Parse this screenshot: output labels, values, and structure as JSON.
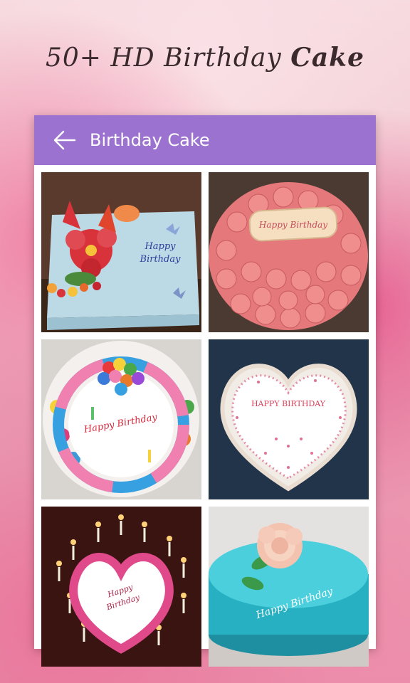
{
  "promo": {
    "headline_prefix": "50+ HD Birthday",
    "headline_emphasis": "Cake"
  },
  "appbar": {
    "back_icon": "arrow-left-icon",
    "title": "Birthday Cake"
  },
  "cakes": [
    {
      "id": "cake-1",
      "caption_line1": "Happy",
      "caption_line2": "Birthday",
      "theme": "light-blue sheet cake with red flowers and butterflies"
    },
    {
      "id": "cake-2",
      "caption_line1": "Happy Birthday",
      "theme": "pink rosette cake with plaque"
    },
    {
      "id": "cake-3",
      "caption_line1": "Happy Birthday",
      "theme": "white cake with rainbow border and balloons"
    },
    {
      "id": "cake-4",
      "caption_line1": "HAPPY BIRTHDAY",
      "theme": "white heart cake with pink sprinkles"
    },
    {
      "id": "cake-5",
      "caption_line1": "Happy",
      "caption_line2": "Birthday",
      "theme": "heart cake with pink balls and candles"
    },
    {
      "id": "cake-6",
      "caption_line1": "Happy Birthday",
      "theme": "teal cake with peach rose"
    }
  ],
  "colors": {
    "appbar": "#9b72cf",
    "panel": "#ffffff"
  }
}
